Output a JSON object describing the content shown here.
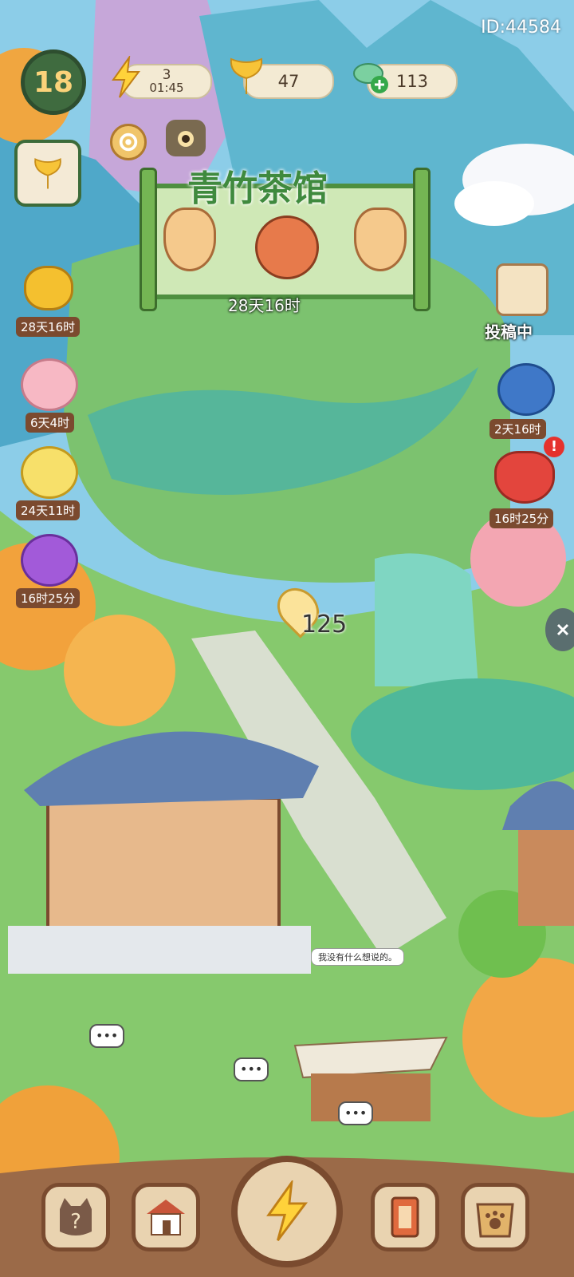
{
  "player": {
    "id_text": "ID:44584",
    "level": "18"
  },
  "resources": {
    "energy": {
      "icon": "lightning-icon",
      "value": "3",
      "timer": "01:45"
    },
    "ginkgo": {
      "icon": "ginkgo-leaf-icon",
      "value": "47"
    },
    "leaf": {
      "icon": "green-leaf-plus-icon",
      "value": "113"
    }
  },
  "event_banner": {
    "title": "青竹茶馆",
    "countdown": "28天16时"
  },
  "left_events": [
    {
      "icon": "golden-teapot-icon",
      "label": "28天16时"
    },
    {
      "icon": "cherry-bird-icon",
      "label": "6天4时"
    },
    {
      "icon": "gold-pile-icon",
      "label": "24天11时"
    },
    {
      "icon": "red-panda-gift-icon",
      "label": "16时25分"
    }
  ],
  "right_events": [
    {
      "icon": "scroll-brush-icon",
      "label": "投稿中"
    },
    {
      "icon": "blue-waterfall-icon",
      "label": "2天16时"
    },
    {
      "icon": "apple-basket-icon",
      "label": "16时25分",
      "alert": "!"
    }
  ],
  "map": {
    "ginkgo_reward": "125",
    "speech_text": "我没有什么想说的。",
    "typing_dots": "•••"
  },
  "bottom_nav": [
    {
      "icon": "cat-help-icon",
      "name": "help"
    },
    {
      "icon": "house-icon",
      "name": "building"
    },
    {
      "icon": "lightning-icon",
      "name": "action"
    },
    {
      "icon": "card-icon",
      "name": "cards"
    },
    {
      "icon": "paw-bag-icon",
      "name": "bag"
    }
  ],
  "colors": {
    "accent_brown": "#7b4a2f",
    "grass": "#7fc36b",
    "sky": "#8fd0ee"
  }
}
